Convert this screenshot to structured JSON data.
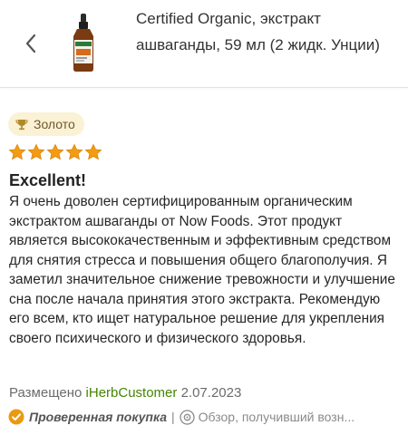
{
  "header": {
    "back_icon": "chevron-left-icon",
    "product_title": "Certified Organic, экстракт ашваганды, 59 мл (2 жидк. Унции)"
  },
  "review": {
    "badge_icon": "trophy-icon",
    "badge_label": "Золото",
    "rating": 5,
    "rating_max": 5,
    "star_color": "#f39c12",
    "title": "Excellent!",
    "body": "Я очень доволен сертифицированным органическим экстрактом ашваганды от Now Foods. Этот продукт является высококачественным и эффективным средством для снятия стресса и повышения общего благополучия. Я заметил значительное снижение тревожности и улучшение сна после начала принятия этого экстракта. Рекомендую его всем, кто ищет натуральное решение для укрепления своего психического и физического здоровья.",
    "posted_prefix": "Размещено",
    "author": "iHerbCustomer",
    "date": "2.07.2023",
    "verified_icon": "check-circle-icon",
    "verified_label": "Проверенная покупка",
    "separator": "|",
    "incentive_icon": "gear-badge-icon",
    "incentive_text": "Обзор, получивший возн..."
  },
  "colors": {
    "author_link": "#458500",
    "badge_bg": "#fbf1d5",
    "verified_check": "#e99a12"
  }
}
